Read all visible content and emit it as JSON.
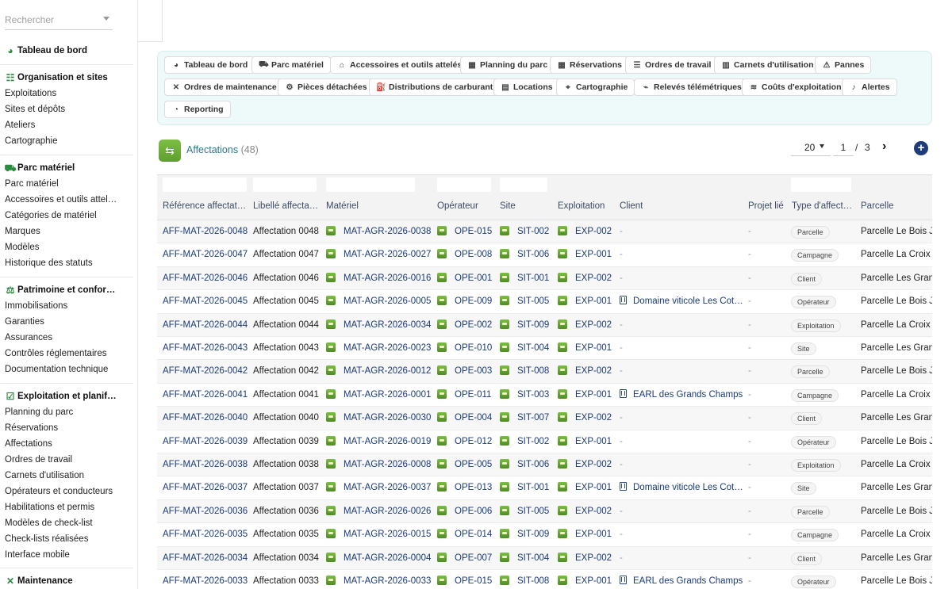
{
  "sidebar": {
    "search_placeholder": "Rechercher",
    "dashboard": "Tableau de bord",
    "sections": [
      {
        "title": "Organisation et sites",
        "items": [
          "Exploitations",
          "Sites et dépôts",
          "Ateliers",
          "Cartographie"
        ]
      },
      {
        "title": "Parc matériel",
        "items": [
          "Parc matériel",
          "Accessoires et outils attel…",
          "Catégories de matériel",
          "Marques",
          "Modèles",
          "Historique des statuts"
        ]
      },
      {
        "title": "Patrimoine et confor…",
        "items": [
          "Immobilisations",
          "Garanties",
          "Assurances",
          "Contrôles réglementaires",
          "Documentation technique"
        ]
      },
      {
        "title": "Exploitation et planif…",
        "items": [
          "Planning du parc",
          "Réservations",
          "Affectations",
          "Ordres de travail",
          "Carnets d'utilisation",
          "Opérateurs et conducteurs",
          "Habilitations et permis",
          "Modèles de check-list",
          "Check-lists réalisées",
          "Interface mobile"
        ]
      },
      {
        "title": "Maintenance",
        "items": []
      }
    ]
  },
  "shortcuts": {
    "row1": [
      "Tableau de bord",
      "Parc matériel",
      "Accessoires et outils attelés",
      "Planning du parc",
      "Réservations",
      "Ordres de travail",
      "Carnets d'utilisation",
      "Pannes"
    ],
    "row2": [
      "Ordres de maintenance",
      "Pièces détachées",
      "Distributions de carburant",
      "Locations",
      "Cartographie",
      "Relevés télémétriques",
      "Coûts d'exploitation",
      "Alertes"
    ],
    "row3": [
      "Reporting"
    ]
  },
  "list": {
    "title": "Affectations",
    "count": "(48)",
    "per_page": "20",
    "page_current": "1",
    "page_sep": "/",
    "page_total": "3",
    "next": "›",
    "add": "+"
  },
  "columns": [
    "Référence affectat…",
    "Libellé affecta…",
    "Matériel",
    "Opérateur",
    "Site",
    "Exploitation",
    "Client",
    "Projet lié",
    "Type d'affect…",
    "Parcelle"
  ],
  "rows": [
    {
      "ref": "AFF-MAT-2026-0048",
      "label": "Affectation 0048",
      "materiel": "MAT-AGR-2026-0038",
      "operateur": "OPE-015",
      "site": "SIT-002",
      "exploitation": "EXP-002",
      "client": "-",
      "projet": "-",
      "type": "Parcelle",
      "parcelle": "Parcelle Le Bois Jo"
    },
    {
      "ref": "AFF-MAT-2026-0047",
      "label": "Affectation 0047",
      "materiel": "MAT-AGR-2026-0027",
      "operateur": "OPE-008",
      "site": "SIT-006",
      "exploitation": "EXP-001",
      "client": "-",
      "projet": "-",
      "type": "Campagne",
      "parcelle": "Parcelle La Croix B"
    },
    {
      "ref": "AFF-MAT-2026-0046",
      "label": "Affectation 0046",
      "materiel": "MAT-AGR-2026-0016",
      "operateur": "OPE-001",
      "site": "SIT-001",
      "exploitation": "EXP-002",
      "client": "-",
      "projet": "-",
      "type": "Client",
      "parcelle": "Parcelle Les Grand"
    },
    {
      "ref": "AFF-MAT-2026-0045",
      "label": "Affectation 0045",
      "materiel": "MAT-AGR-2026-0005",
      "operateur": "OPE-009",
      "site": "SIT-005",
      "exploitation": "EXP-001",
      "client": "Domaine viticole Les Cot…",
      "projet": "-",
      "type": "Opérateur",
      "parcelle": "Parcelle Le Bois Jo"
    },
    {
      "ref": "AFF-MAT-2026-0044",
      "label": "Affectation 0044",
      "materiel": "MAT-AGR-2026-0034",
      "operateur": "OPE-002",
      "site": "SIT-009",
      "exploitation": "EXP-002",
      "client": "-",
      "projet": "-",
      "type": "Exploitation",
      "parcelle": "Parcelle La Croix B"
    },
    {
      "ref": "AFF-MAT-2026-0043",
      "label": "Affectation 0043",
      "materiel": "MAT-AGR-2026-0023",
      "operateur": "OPE-010",
      "site": "SIT-004",
      "exploitation": "EXP-001",
      "client": "-",
      "projet": "-",
      "type": "Site",
      "parcelle": "Parcelle Les Grand"
    },
    {
      "ref": "AFF-MAT-2026-0042",
      "label": "Affectation 0042",
      "materiel": "MAT-AGR-2026-0012",
      "operateur": "OPE-003",
      "site": "SIT-008",
      "exploitation": "EXP-002",
      "client": "-",
      "projet": "-",
      "type": "Parcelle",
      "parcelle": "Parcelle Le Bois Jo"
    },
    {
      "ref": "AFF-MAT-2026-0041",
      "label": "Affectation 0041",
      "materiel": "MAT-AGR-2026-0001",
      "operateur": "OPE-011",
      "site": "SIT-003",
      "exploitation": "EXP-001",
      "client": "EARL des Grands Champs",
      "projet": "-",
      "type": "Campagne",
      "parcelle": "Parcelle La Croix B"
    },
    {
      "ref": "AFF-MAT-2026-0040",
      "label": "Affectation 0040",
      "materiel": "MAT-AGR-2026-0030",
      "operateur": "OPE-004",
      "site": "SIT-007",
      "exploitation": "EXP-002",
      "client": "-",
      "projet": "-",
      "type": "Client",
      "parcelle": "Parcelle Les Grand"
    },
    {
      "ref": "AFF-MAT-2026-0039",
      "label": "Affectation 0039",
      "materiel": "MAT-AGR-2026-0019",
      "operateur": "OPE-012",
      "site": "SIT-002",
      "exploitation": "EXP-001",
      "client": "-",
      "projet": "-",
      "type": "Opérateur",
      "parcelle": "Parcelle Le Bois Jo"
    },
    {
      "ref": "AFF-MAT-2026-0038",
      "label": "Affectation 0038",
      "materiel": "MAT-AGR-2026-0008",
      "operateur": "OPE-005",
      "site": "SIT-006",
      "exploitation": "EXP-002",
      "client": "-",
      "projet": "-",
      "type": "Exploitation",
      "parcelle": "Parcelle La Croix B"
    },
    {
      "ref": "AFF-MAT-2026-0037",
      "label": "Affectation 0037",
      "materiel": "MAT-AGR-2026-0037",
      "operateur": "OPE-013",
      "site": "SIT-001",
      "exploitation": "EXP-001",
      "client": "Domaine viticole Les Cot…",
      "projet": "-",
      "type": "Site",
      "parcelle": "Parcelle Les Grand"
    },
    {
      "ref": "AFF-MAT-2026-0036",
      "label": "Affectation 0036",
      "materiel": "MAT-AGR-2026-0026",
      "operateur": "OPE-006",
      "site": "SIT-005",
      "exploitation": "EXP-002",
      "client": "-",
      "projet": "-",
      "type": "Parcelle",
      "parcelle": "Parcelle Le Bois Jo"
    },
    {
      "ref": "AFF-MAT-2026-0035",
      "label": "Affectation 0035",
      "materiel": "MAT-AGR-2026-0015",
      "operateur": "OPE-014",
      "site": "SIT-009",
      "exploitation": "EXP-001",
      "client": "-",
      "projet": "-",
      "type": "Campagne",
      "parcelle": "Parcelle La Croix B"
    },
    {
      "ref": "AFF-MAT-2026-0034",
      "label": "Affectation 0034",
      "materiel": "MAT-AGR-2026-0004",
      "operateur": "OPE-007",
      "site": "SIT-004",
      "exploitation": "EXP-002",
      "client": "-",
      "projet": "-",
      "type": "Client",
      "parcelle": "Parcelle Les Grand"
    },
    {
      "ref": "AFF-MAT-2026-0033",
      "label": "Affectation 0033",
      "materiel": "MAT-AGR-2026-0033",
      "operateur": "OPE-015",
      "site": "SIT-008",
      "exploitation": "EXP-001",
      "client": "EARL des Grands Champs",
      "projet": "-",
      "type": "Opérateur",
      "parcelle": "Parcelle Le Bois Jo"
    }
  ]
}
